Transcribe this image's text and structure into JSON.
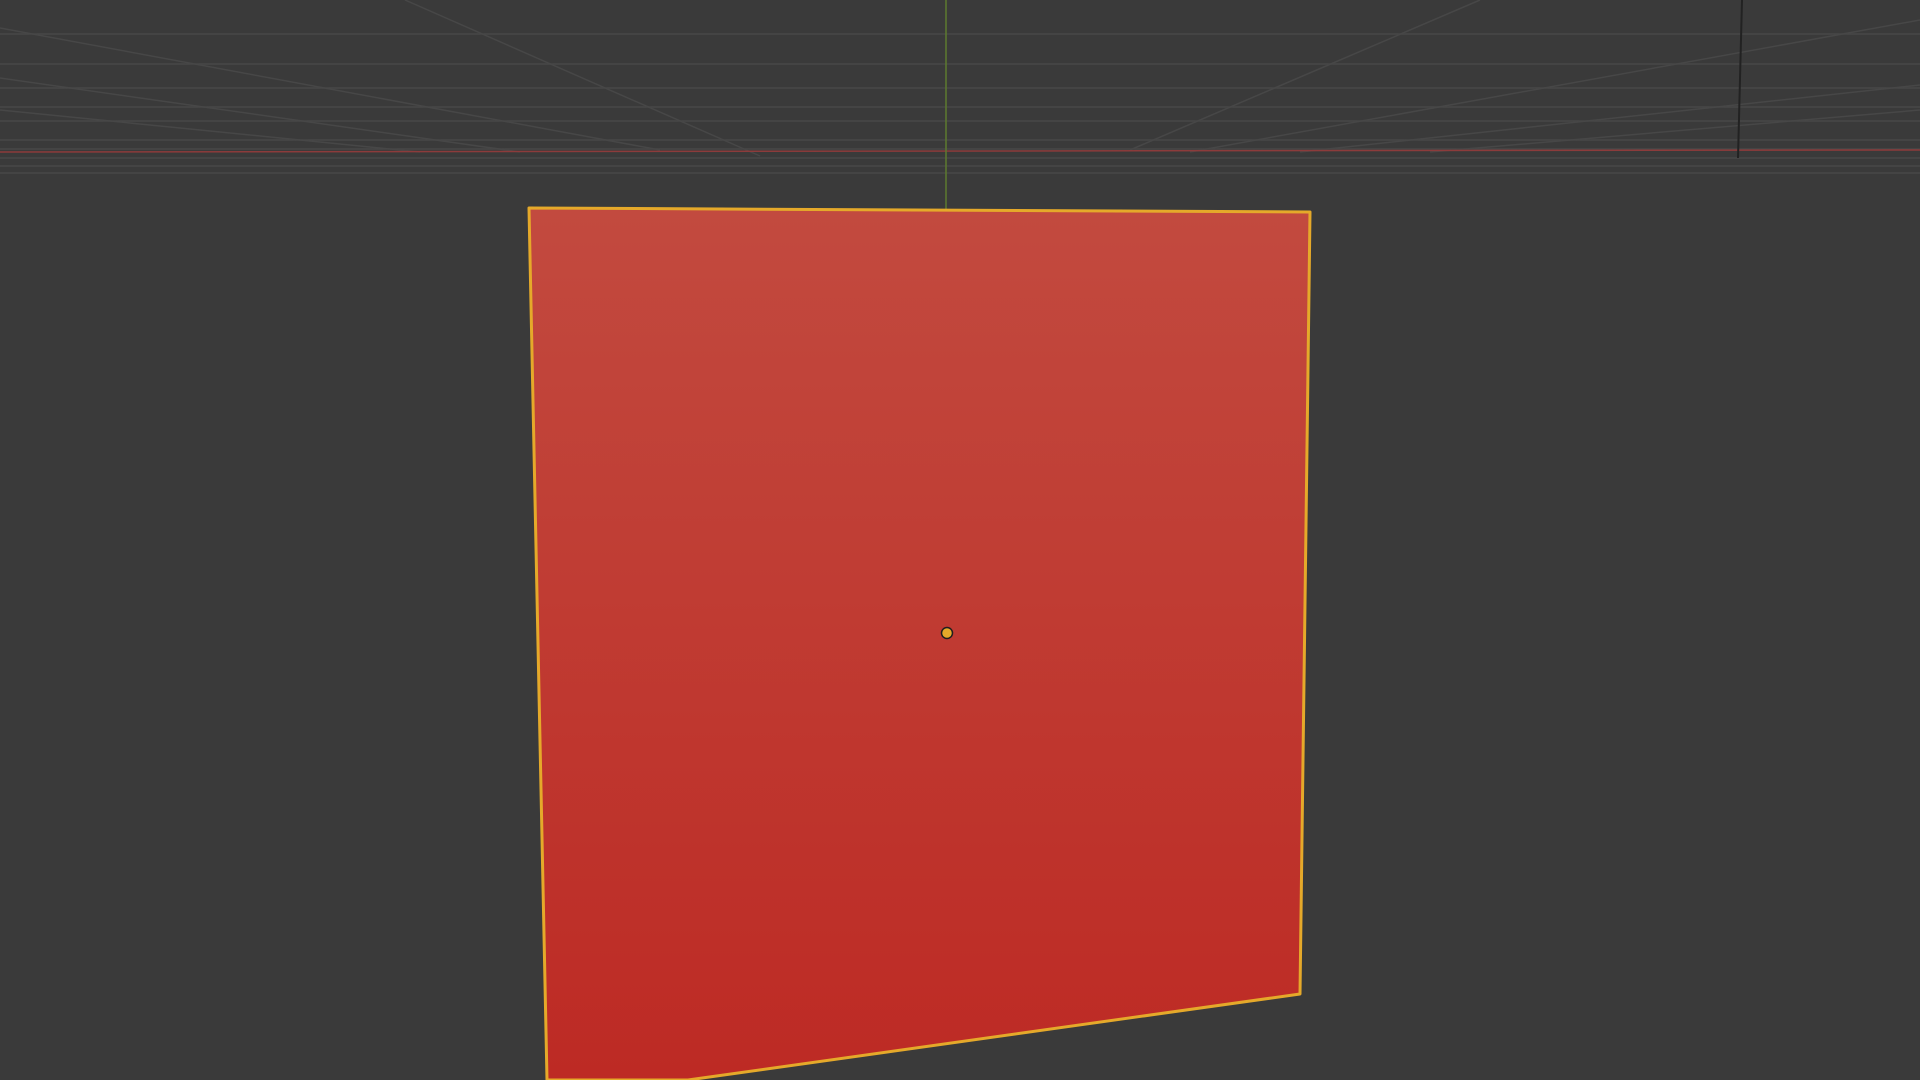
{
  "viewport": {
    "background": "#3a3a3a",
    "grid_line_color": "#474747",
    "x_axis_color": "#8c3b3b",
    "y_axis_color": "#5d7a2e",
    "z_axis_color": "#222222"
  },
  "scene": {
    "selected_object": {
      "type": "plane",
      "fill_top": "#c24a3f",
      "fill_bottom": "#bd2a24",
      "outline_color": "#e5a92a",
      "origin_color": "#e5a92a",
      "selected": true
    }
  }
}
